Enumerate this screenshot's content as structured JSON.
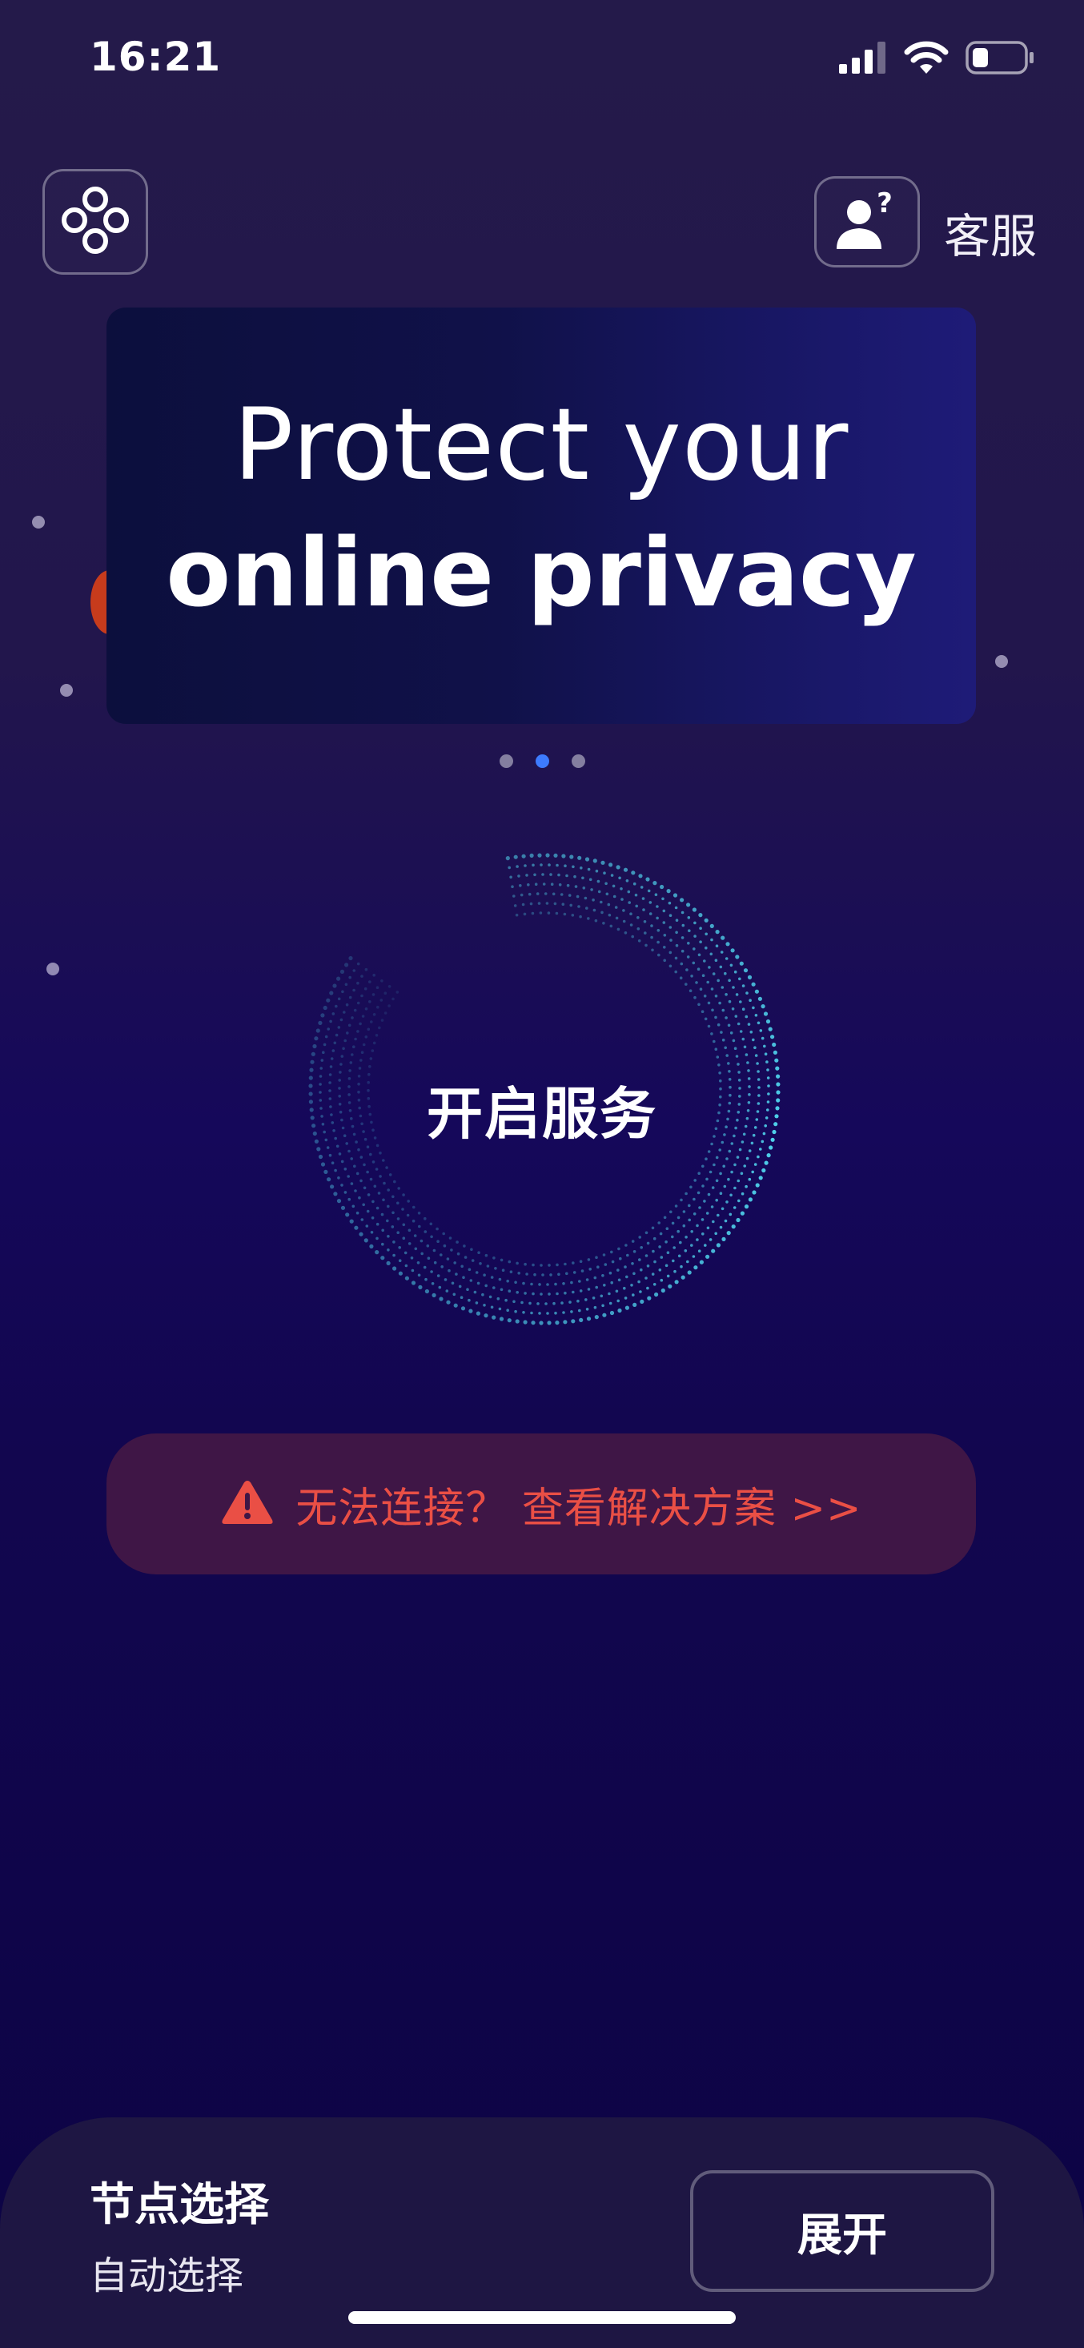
{
  "status_bar": {
    "time": "16:21",
    "icons": [
      "signal-icon",
      "wifi-icon",
      "battery-icon"
    ]
  },
  "header": {
    "menu_icon": "nodes-menu-icon",
    "support_icon": "user-question-icon",
    "support_label": "客服"
  },
  "banner": {
    "line1": "Protect your",
    "line2": "online privacy",
    "page_count": 3,
    "active_page": 2
  },
  "connect": {
    "label": "开启服务",
    "ring_color": "#4fd0ea"
  },
  "help": {
    "icon": "warning-icon",
    "text": "无法连接？ 查看解决方案 >>",
    "color": "#ea4f45"
  },
  "node_panel": {
    "title": "节点选择",
    "value": "自动选择",
    "expand_label": "展开"
  }
}
